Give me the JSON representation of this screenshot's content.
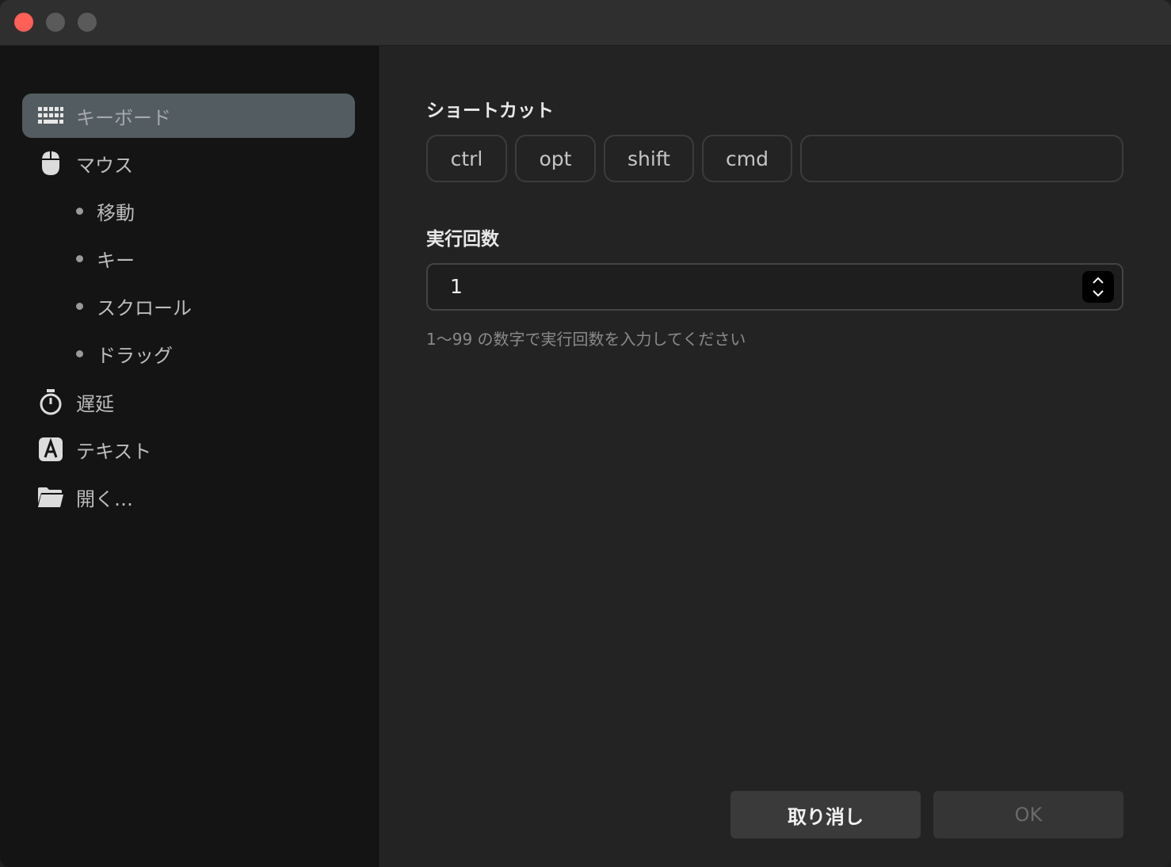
{
  "sidebar": {
    "items": [
      {
        "label": "キーボード",
        "icon": "keyboard-icon"
      },
      {
        "label": "マウス",
        "icon": "mouse-icon"
      },
      {
        "label": "遅延",
        "icon": "stopwatch-icon"
      },
      {
        "label": "テキスト",
        "icon": "text-a-icon"
      },
      {
        "label": "開く…",
        "icon": "folder-icon"
      }
    ],
    "mouse_sub_items": [
      {
        "label": "移動"
      },
      {
        "label": "キー"
      },
      {
        "label": "スクロール"
      },
      {
        "label": "ドラッグ"
      }
    ],
    "selected": "キーボード"
  },
  "main": {
    "shortcut_title": "ショートカット",
    "modifiers": [
      {
        "label": "ctrl"
      },
      {
        "label": "opt"
      },
      {
        "label": "shift"
      },
      {
        "label": "cmd"
      }
    ],
    "key_value": "",
    "count_title": "実行回数",
    "count_value": "1",
    "helper_text": "1〜99 の数字で実行回数を入力してください"
  },
  "footer": {
    "cancel_label": "取り消し",
    "ok_label": "OK"
  },
  "colors": {
    "close": "#fe5f57",
    "selected_bg": "#535c60",
    "sidebar_bg": "#141414",
    "content_bg": "#232323"
  }
}
